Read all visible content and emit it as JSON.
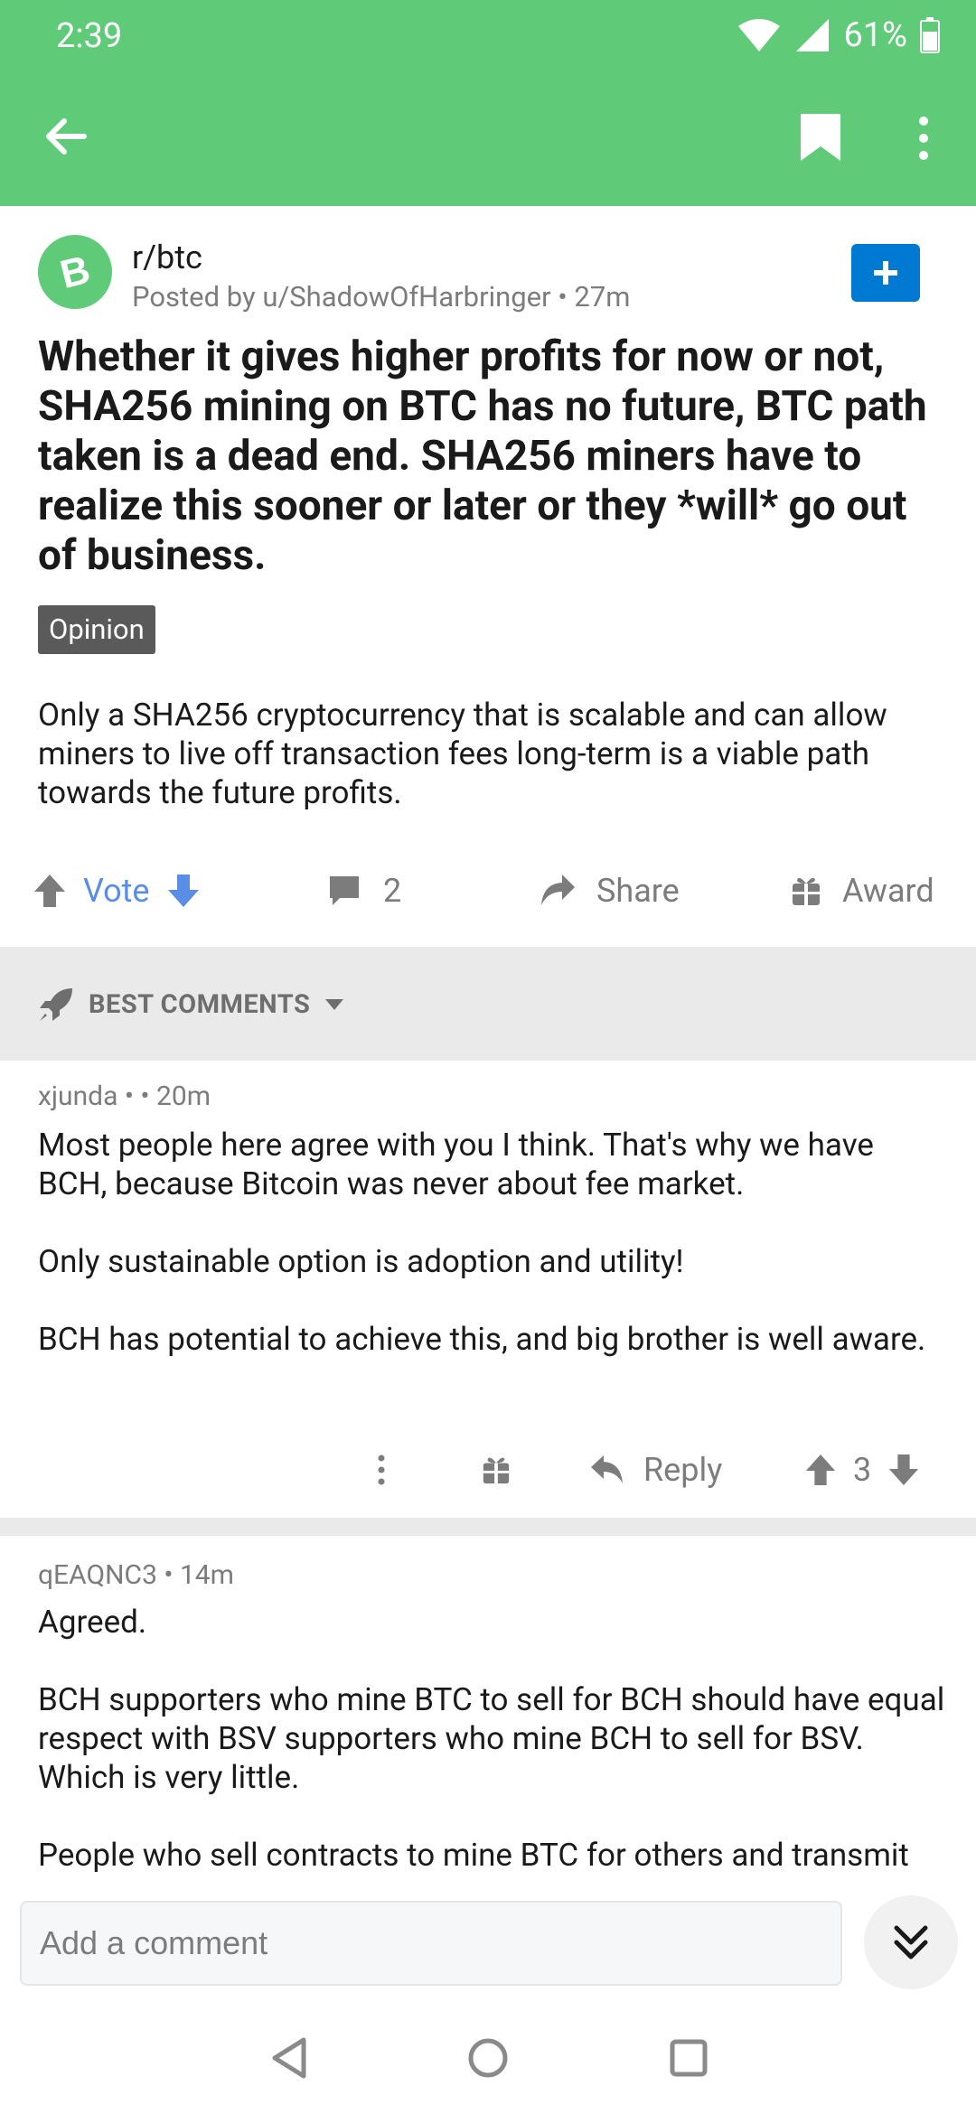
{
  "status_bar": {
    "time": "2:39",
    "battery": "61%"
  },
  "toolbar": {
    "back_icon": "arrow-left-icon",
    "bookmark_icon": "bookmark-icon",
    "more_icon": "more-vertical-icon"
  },
  "colors": {
    "header_green": "#5fcb79",
    "accent_blue": "#0079d3",
    "vote_blue": "#5a8de6",
    "flair_bg": "#5a5a5a"
  },
  "post": {
    "subreddit": "r/btc",
    "meta": "Posted by u/ShadowOfHarbringer • 27m",
    "title": "Whether it gives higher profits for now or not, SHA256 mining on BTC has no future, BTC path taken is a dead end. SHA256 miners have to realize this sooner or later or they *will* go out of business.",
    "flair": "Opinion",
    "body": "Only a SHA256 cryptocurrency that is scalable and can allow miners to live off transaction fees long-term is a viable path towards the future profits."
  },
  "actions": {
    "vote_label": "Vote",
    "comment_count": "2",
    "share_label": "Share",
    "award_label": "Award"
  },
  "sort": {
    "label": "BEST COMMENTS"
  },
  "comments": [
    {
      "meta": "xjunda •  • 20m",
      "paragraphs": [
        "Most people here agree with you I think. That's why we have BCH, because Bitcoin was never about fee market.",
        "Only sustainable option is adoption and utility!",
        "BCH has potential to achieve this, and big brother is well aware."
      ],
      "reply_label": "Reply",
      "score": "3"
    },
    {
      "meta": "qEAQNC3 • 14m",
      "paragraphs": [
        "Agreed.",
        "BCH supporters who mine BTC to sell for BCH should have equal respect with BSV supporters who mine BCH to sell for BSV. Which is very little.",
        "People who sell contracts to mine BTC for others and transmit"
      ]
    }
  ],
  "composer": {
    "placeholder": "Add a comment"
  }
}
